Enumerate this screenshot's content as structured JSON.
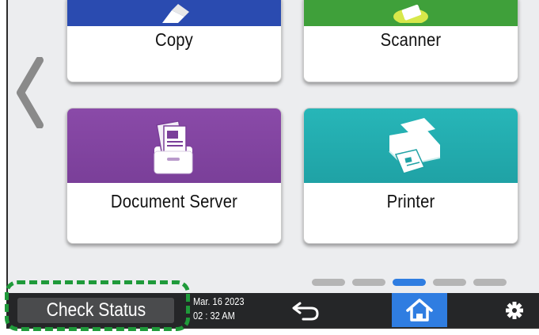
{
  "tiles": {
    "copy": {
      "label": "Copy",
      "color": "#2a4bb0"
    },
    "scanner": {
      "label": "Scanner",
      "color": "#3fa03a"
    },
    "document_server": {
      "label": "Document Server",
      "color": "#7a3f99",
      "icon": "document-server-icon"
    },
    "printer": {
      "label": "Printer",
      "color": "#1fa2a5",
      "icon": "printer-icon"
    }
  },
  "navigation": {
    "prev_icon": "chevron-left-icon"
  },
  "pager": {
    "pages": 5,
    "active_index": 2,
    "active_color": "#2f7de1"
  },
  "bottom_bar": {
    "check_status_label": "Check Status",
    "date": "Mar. 16 2023",
    "time": "02 : 32 AM",
    "back_icon": "back-arrow-icon",
    "home_icon": "home-icon",
    "settings_icon": "gear-icon",
    "home_active_color": "#2f7de1"
  },
  "highlight": {
    "style": "dashed",
    "color": "#1f9a3a"
  }
}
